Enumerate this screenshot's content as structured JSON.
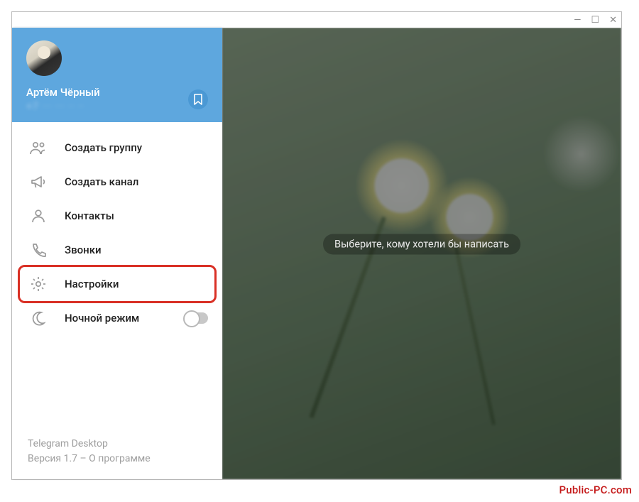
{
  "header": {
    "username": "Артём Чёрный",
    "phone": "+7 ··· ··· ·· ··"
  },
  "menu": {
    "new_group": "Создать группу",
    "new_channel": "Создать канал",
    "contacts": "Контакты",
    "calls": "Звонки",
    "settings": "Настройки",
    "night_mode": "Ночной режим"
  },
  "footer": {
    "app_name": "Telegram Desktop",
    "version_line": "Версия 1.7 – О программе"
  },
  "main": {
    "placeholder": "Выберите, кому хотели бы написать"
  },
  "watermark": "Public-PC.com"
}
